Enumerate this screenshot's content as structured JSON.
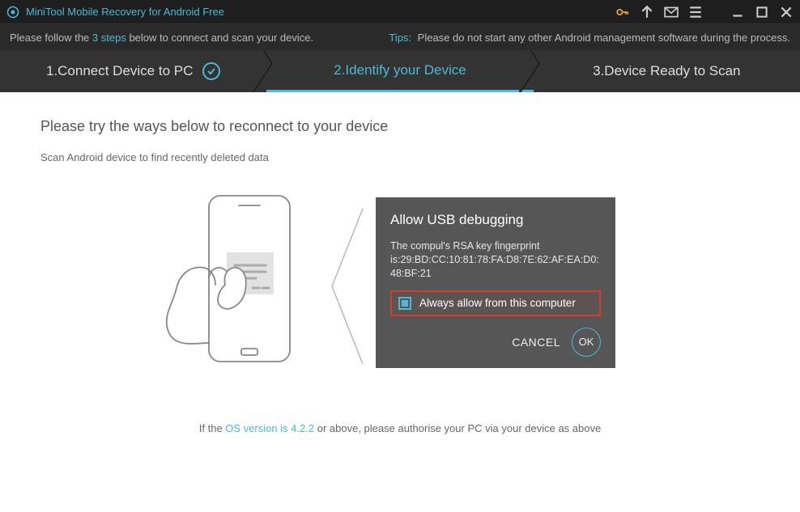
{
  "titlebar": {
    "app_title": "MiniTool Mobile Recovery for Android Free"
  },
  "infobar": {
    "left_pre": "Please follow the ",
    "left_link": "3 steps",
    "left_post": " below to connect and scan your device.",
    "tips_label": "Tips:",
    "tips_text": "Please do not start any other Android management software during the process."
  },
  "steps": {
    "s1": "1.Connect Device to PC",
    "s2": "2.Identify your Device",
    "s3": "3.Device Ready to Scan"
  },
  "main": {
    "heading": "Please try the ways below to reconnect to your device",
    "subheading": "Scan Android device to find recently deleted data"
  },
  "dialog": {
    "title": "Allow USB debugging",
    "text": "The compul's RSA key fingerprint is:29:BD:CC:10:81:78:FA:D8:7E:62:AF:EA:D0:48:BF:21",
    "always_label": "Always allow from this computer",
    "cancel": "CANCEL",
    "ok": "OK"
  },
  "footer": {
    "pre": "If the ",
    "link": "OS version is 4.2.2",
    "post": " or above, please authorise your PC via your device as above"
  },
  "colors": {
    "accent": "#4db8d8",
    "highlight_border": "#d53a2a",
    "dialog_bg": "#565656"
  }
}
